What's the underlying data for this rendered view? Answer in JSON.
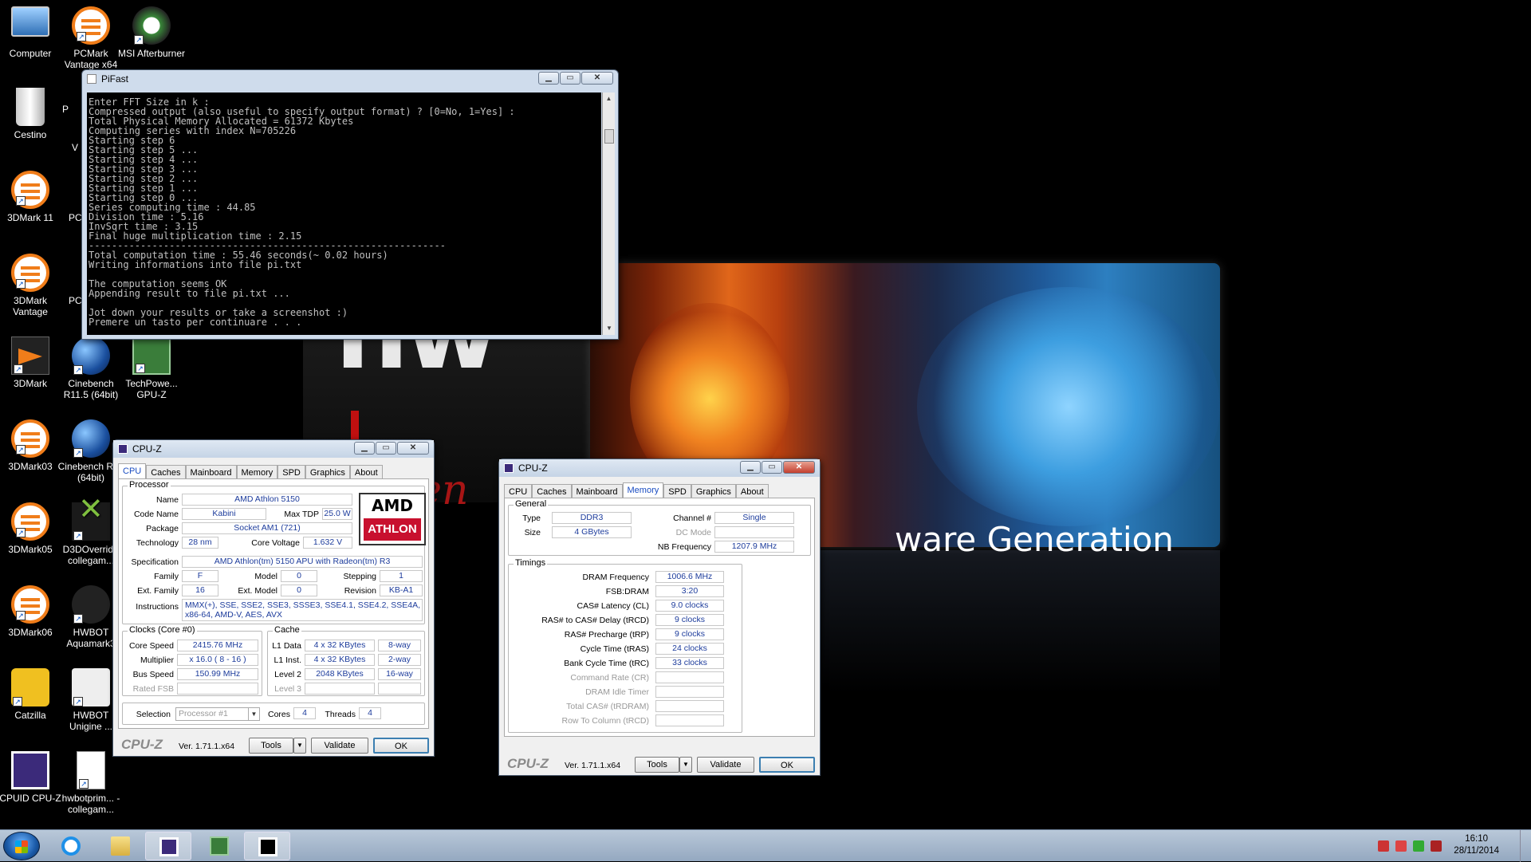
{
  "desktop": {
    "icons": [
      {
        "label": "Computer",
        "icon": "computer-icon"
      },
      {
        "label": "PCMark Vantage x64",
        "icon": "pcmark-icon"
      },
      {
        "label": "MSI Afterburner",
        "icon": "msi-afterburner-icon"
      },
      {
        "label": "Cestino",
        "icon": "recycle-bin-icon"
      },
      {
        "label": "3DMark 11",
        "icon": "3dmark11-icon"
      },
      {
        "label": "3DMark Vantage",
        "icon": "3dmark-vantage-icon"
      },
      {
        "label": "3DMark",
        "icon": "3dmark-icon"
      },
      {
        "label": "Cinebench R11.5 (64bit)",
        "icon": "cinebench-r115-icon"
      },
      {
        "label": "TechPowe... GPU-Z",
        "icon": "gpu-z-icon"
      },
      {
        "label": "3DMark03",
        "icon": "3dmark03-icon"
      },
      {
        "label": "Cinebench R15 (64bit)",
        "icon": "cinebench-r15-icon"
      },
      {
        "label": "3DMark05",
        "icon": "3dmark05-icon"
      },
      {
        "label": "D3DOverrid - collegam...",
        "icon": "d3doverrider-icon"
      },
      {
        "label": "3DMark06",
        "icon": "3dmark06-icon"
      },
      {
        "label": "HWBOT Aquamark3",
        "icon": "hwbot-aquamark-icon"
      },
      {
        "label": "Catzilla",
        "icon": "catzilla-icon"
      },
      {
        "label": "HWBOT Unigine ...",
        "icon": "hwbot-unigine-icon"
      },
      {
        "label": "CPUID CPU-Z",
        "icon": "cpuid-cpuz-icon"
      },
      {
        "label": "hwbotprim... - collegam...",
        "icon": "hwbotprime-icon"
      }
    ],
    "partial_labels": [
      "P",
      "V",
      "PC",
      "PC"
    ],
    "wallpaper": {
      "tagline": "ware Generation",
      "red_text": "gen"
    }
  },
  "pifast": {
    "title": "PiFast",
    "lines": [
      "Enter FFT Size in k :",
      "Compressed output (also useful to specify output format) ? [0=No, 1=Yes] :",
      "Total Physical Memory Allocated = 61372 Kbytes",
      "Computing series with index N=705226",
      "Starting step 6",
      "Starting step 5 ...",
      "Starting step 4 ...",
      "Starting step 3 ...",
      "Starting step 2 ...",
      "Starting step 1 ...",
      "Starting step 0 ...",
      "Series computing time : 44.85",
      "Division time : 5.16",
      "InvSqrt time : 3.15",
      "Final huge multiplication time : 2.15",
      "--------------------------------------------------------------",
      "Total computation time : 55.46 seconds(~ 0.02 hours)",
      "Writing informations into file pi.txt",
      "",
      "The computation seems OK",
      "Appending result to file pi.txt ...",
      "",
      "Jot down your results or take a screenshot :)",
      "Premere un tasto per continuare . . ."
    ]
  },
  "cpuz_cpu": {
    "title": "CPU-Z",
    "tabs": [
      "CPU",
      "Caches",
      "Mainboard",
      "Memory",
      "SPD",
      "Graphics",
      "About"
    ],
    "active_tab": "CPU",
    "processor_label": "Processor",
    "labels": {
      "name": "Name",
      "code_name": "Code Name",
      "max_tdp": "Max TDP",
      "package": "Package",
      "technology": "Technology",
      "core_voltage": "Core Voltage",
      "specification": "Specification",
      "family": "Family",
      "model": "Model",
      "stepping": "Stepping",
      "ext_family": "Ext. Family",
      "ext_model": "Ext. Model",
      "revision": "Revision",
      "instructions": "Instructions",
      "clocks": "Clocks (Core #0)",
      "core_speed": "Core Speed",
      "multiplier": "Multiplier",
      "bus_speed": "Bus Speed",
      "rated_fsb": "Rated FSB",
      "cache": "Cache",
      "l1_data": "L1 Data",
      "l1_inst": "L1 Inst.",
      "level2": "Level 2",
      "level3": "Level 3",
      "selection": "Selection",
      "cores": "Cores",
      "threads": "Threads"
    },
    "values": {
      "name": "AMD Athlon 5150",
      "code_name": "Kabini",
      "max_tdp": "25.0 W",
      "package": "Socket AM1 (721)",
      "technology": "28 nm",
      "core_voltage": "1.632 V",
      "specification": "AMD Athlon(tm) 5150 APU with Radeon(tm) R3",
      "family": "F",
      "model": "0",
      "stepping": "1",
      "ext_family": "16",
      "ext_model": "0",
      "revision": "KB-A1",
      "instructions": "MMX(+), SSE, SSE2, SSE3, SSSE3, SSE4.1, SSE4.2, SSE4A, x86-64, AMD-V, AES, AVX",
      "core_speed": "2415.76 MHz",
      "multiplier": "x 16.0 ( 8 - 16 )",
      "bus_speed": "150.99 MHz",
      "rated_fsb": "",
      "l1_data": "4 x 32 KBytes",
      "l1_data_way": "8-way",
      "l1_inst": "4 x 32 KBytes",
      "l1_inst_way": "2-way",
      "level2": "2048 KBytes",
      "level2_way": "16-way",
      "level3": "",
      "level3_way": "",
      "selection": "Processor #1",
      "cores": "4",
      "threads": "4"
    },
    "logo": {
      "brand": "AMD",
      "product": "ATHLON"
    },
    "footer": {
      "brand": "CPU-Z",
      "version": "Ver. 1.71.1.x64",
      "tools": "Tools",
      "validate": "Validate",
      "ok": "OK"
    }
  },
  "cpuz_mem": {
    "title": "CPU-Z",
    "tabs": [
      "CPU",
      "Caches",
      "Mainboard",
      "Memory",
      "SPD",
      "Graphics",
      "About"
    ],
    "active_tab": "Memory",
    "general_label": "General",
    "timings_label": "Timings",
    "labels": {
      "type": "Type",
      "size": "Size",
      "channel": "Channel #",
      "dc_mode": "DC Mode",
      "nb_freq": "NB Frequency",
      "dram_freq": "DRAM Frequency",
      "fsb_dram": "FSB:DRAM",
      "cas": "CAS# Latency (CL)",
      "rcd": "RAS# to CAS# Delay (tRCD)",
      "rp": "RAS# Precharge (tRP)",
      "ras": "Cycle Time (tRAS)",
      "rc": "Bank Cycle Time (tRC)",
      "cr": "Command Rate (CR)",
      "idle": "DRAM Idle Timer",
      "trdram": "Total CAS# (tRDRAM)",
      "trcd2": "Row To Column (tRCD)"
    },
    "values": {
      "type": "DDR3",
      "size": "4 GBytes",
      "channel": "Single",
      "dc_mode": "",
      "nb_freq": "1207.9 MHz",
      "dram_freq": "1006.6 MHz",
      "fsb_dram": "3:20",
      "cas": "9.0 clocks",
      "rcd": "9 clocks",
      "rp": "9 clocks",
      "ras": "24 clocks",
      "rc": "33 clocks",
      "cr": "",
      "idle": "",
      "trdram": "",
      "trcd2": ""
    },
    "footer": {
      "brand": "CPU-Z",
      "version": "Ver. 1.71.1.x64",
      "tools": "Tools",
      "validate": "Validate",
      "ok": "OK"
    }
  },
  "taskbar": {
    "clock_time": "16:10",
    "clock_date": "28/11/2014"
  },
  "colors": {
    "value_text": "#1d3c9c",
    "active_tab": "#1a4dc2",
    "taskbar": "#a8b8cc"
  }
}
